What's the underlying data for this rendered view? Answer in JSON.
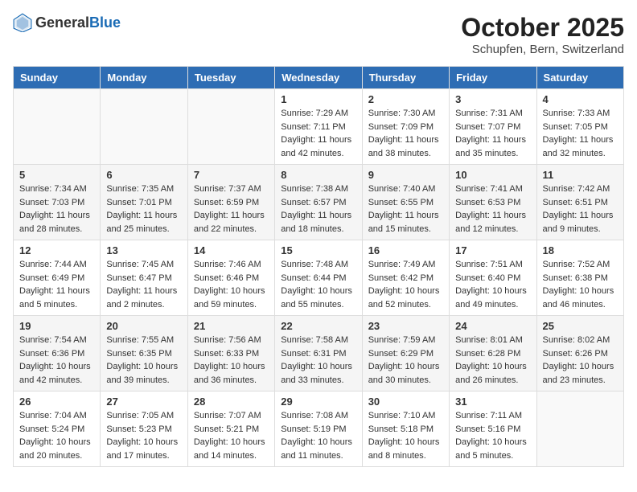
{
  "header": {
    "logo": {
      "text_general": "General",
      "text_blue": "Blue"
    },
    "month": "October 2025",
    "location": "Schupfen, Bern, Switzerland"
  },
  "days_of_week": [
    "Sunday",
    "Monday",
    "Tuesday",
    "Wednesday",
    "Thursday",
    "Friday",
    "Saturday"
  ],
  "weeks": [
    [
      {
        "day": "",
        "sunrise": "",
        "sunset": "",
        "daylight": ""
      },
      {
        "day": "",
        "sunrise": "",
        "sunset": "",
        "daylight": ""
      },
      {
        "day": "",
        "sunrise": "",
        "sunset": "",
        "daylight": ""
      },
      {
        "day": "1",
        "sunrise": "Sunrise: 7:29 AM",
        "sunset": "Sunset: 7:11 PM",
        "daylight": "Daylight: 11 hours and 42 minutes."
      },
      {
        "day": "2",
        "sunrise": "Sunrise: 7:30 AM",
        "sunset": "Sunset: 7:09 PM",
        "daylight": "Daylight: 11 hours and 38 minutes."
      },
      {
        "day": "3",
        "sunrise": "Sunrise: 7:31 AM",
        "sunset": "Sunset: 7:07 PM",
        "daylight": "Daylight: 11 hours and 35 minutes."
      },
      {
        "day": "4",
        "sunrise": "Sunrise: 7:33 AM",
        "sunset": "Sunset: 7:05 PM",
        "daylight": "Daylight: 11 hours and 32 minutes."
      }
    ],
    [
      {
        "day": "5",
        "sunrise": "Sunrise: 7:34 AM",
        "sunset": "Sunset: 7:03 PM",
        "daylight": "Daylight: 11 hours and 28 minutes."
      },
      {
        "day": "6",
        "sunrise": "Sunrise: 7:35 AM",
        "sunset": "Sunset: 7:01 PM",
        "daylight": "Daylight: 11 hours and 25 minutes."
      },
      {
        "day": "7",
        "sunrise": "Sunrise: 7:37 AM",
        "sunset": "Sunset: 6:59 PM",
        "daylight": "Daylight: 11 hours and 22 minutes."
      },
      {
        "day": "8",
        "sunrise": "Sunrise: 7:38 AM",
        "sunset": "Sunset: 6:57 PM",
        "daylight": "Daylight: 11 hours and 18 minutes."
      },
      {
        "day": "9",
        "sunrise": "Sunrise: 7:40 AM",
        "sunset": "Sunset: 6:55 PM",
        "daylight": "Daylight: 11 hours and 15 minutes."
      },
      {
        "day": "10",
        "sunrise": "Sunrise: 7:41 AM",
        "sunset": "Sunset: 6:53 PM",
        "daylight": "Daylight: 11 hours and 12 minutes."
      },
      {
        "day": "11",
        "sunrise": "Sunrise: 7:42 AM",
        "sunset": "Sunset: 6:51 PM",
        "daylight": "Daylight: 11 hours and 9 minutes."
      }
    ],
    [
      {
        "day": "12",
        "sunrise": "Sunrise: 7:44 AM",
        "sunset": "Sunset: 6:49 PM",
        "daylight": "Daylight: 11 hours and 5 minutes."
      },
      {
        "day": "13",
        "sunrise": "Sunrise: 7:45 AM",
        "sunset": "Sunset: 6:47 PM",
        "daylight": "Daylight: 11 hours and 2 minutes."
      },
      {
        "day": "14",
        "sunrise": "Sunrise: 7:46 AM",
        "sunset": "Sunset: 6:46 PM",
        "daylight": "Daylight: 10 hours and 59 minutes."
      },
      {
        "day": "15",
        "sunrise": "Sunrise: 7:48 AM",
        "sunset": "Sunset: 6:44 PM",
        "daylight": "Daylight: 10 hours and 55 minutes."
      },
      {
        "day": "16",
        "sunrise": "Sunrise: 7:49 AM",
        "sunset": "Sunset: 6:42 PM",
        "daylight": "Daylight: 10 hours and 52 minutes."
      },
      {
        "day": "17",
        "sunrise": "Sunrise: 7:51 AM",
        "sunset": "Sunset: 6:40 PM",
        "daylight": "Daylight: 10 hours and 49 minutes."
      },
      {
        "day": "18",
        "sunrise": "Sunrise: 7:52 AM",
        "sunset": "Sunset: 6:38 PM",
        "daylight": "Daylight: 10 hours and 46 minutes."
      }
    ],
    [
      {
        "day": "19",
        "sunrise": "Sunrise: 7:54 AM",
        "sunset": "Sunset: 6:36 PM",
        "daylight": "Daylight: 10 hours and 42 minutes."
      },
      {
        "day": "20",
        "sunrise": "Sunrise: 7:55 AM",
        "sunset": "Sunset: 6:35 PM",
        "daylight": "Daylight: 10 hours and 39 minutes."
      },
      {
        "day": "21",
        "sunrise": "Sunrise: 7:56 AM",
        "sunset": "Sunset: 6:33 PM",
        "daylight": "Daylight: 10 hours and 36 minutes."
      },
      {
        "day": "22",
        "sunrise": "Sunrise: 7:58 AM",
        "sunset": "Sunset: 6:31 PM",
        "daylight": "Daylight: 10 hours and 33 minutes."
      },
      {
        "day": "23",
        "sunrise": "Sunrise: 7:59 AM",
        "sunset": "Sunset: 6:29 PM",
        "daylight": "Daylight: 10 hours and 30 minutes."
      },
      {
        "day": "24",
        "sunrise": "Sunrise: 8:01 AM",
        "sunset": "Sunset: 6:28 PM",
        "daylight": "Daylight: 10 hours and 26 minutes."
      },
      {
        "day": "25",
        "sunrise": "Sunrise: 8:02 AM",
        "sunset": "Sunset: 6:26 PM",
        "daylight": "Daylight: 10 hours and 23 minutes."
      }
    ],
    [
      {
        "day": "26",
        "sunrise": "Sunrise: 7:04 AM",
        "sunset": "Sunset: 5:24 PM",
        "daylight": "Daylight: 10 hours and 20 minutes."
      },
      {
        "day": "27",
        "sunrise": "Sunrise: 7:05 AM",
        "sunset": "Sunset: 5:23 PM",
        "daylight": "Daylight: 10 hours and 17 minutes."
      },
      {
        "day": "28",
        "sunrise": "Sunrise: 7:07 AM",
        "sunset": "Sunset: 5:21 PM",
        "daylight": "Daylight: 10 hours and 14 minutes."
      },
      {
        "day": "29",
        "sunrise": "Sunrise: 7:08 AM",
        "sunset": "Sunset: 5:19 PM",
        "daylight": "Daylight: 10 hours and 11 minutes."
      },
      {
        "day": "30",
        "sunrise": "Sunrise: 7:10 AM",
        "sunset": "Sunset: 5:18 PM",
        "daylight": "Daylight: 10 hours and 8 minutes."
      },
      {
        "day": "31",
        "sunrise": "Sunrise: 7:11 AM",
        "sunset": "Sunset: 5:16 PM",
        "daylight": "Daylight: 10 hours and 5 minutes."
      },
      {
        "day": "",
        "sunrise": "",
        "sunset": "",
        "daylight": ""
      }
    ]
  ]
}
